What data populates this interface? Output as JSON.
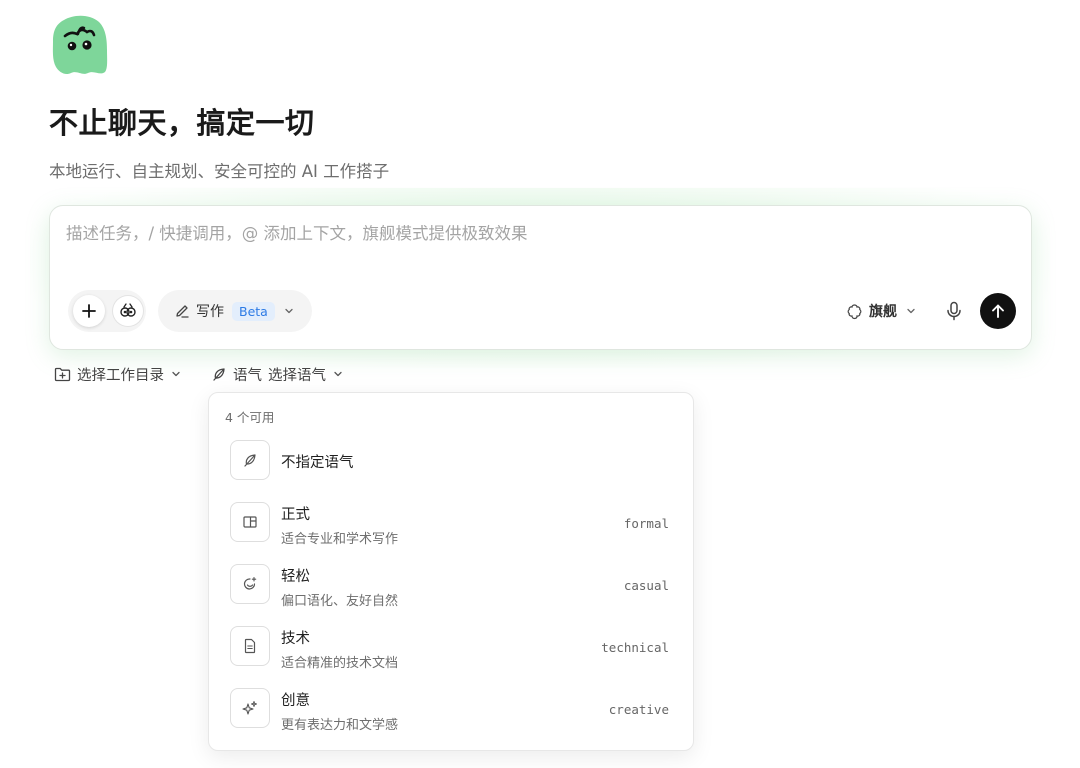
{
  "hero": {
    "title": "不止聊天，搞定一切",
    "subtitle": "本地运行、自主规划、安全可控的 AI 工作搭子"
  },
  "composer": {
    "placeholder": "描述任务，/ 快捷调用，@ 添加上下文，旗舰模式提供极致效果",
    "value": "",
    "mode_label": "写作",
    "mode_badge": "Beta",
    "model_label": "旗舰",
    "icons": {
      "add": "plus-icon",
      "agent": "agent-icon",
      "mode": "pen-icon",
      "model": "flower-icon",
      "voice": "microphone-icon",
      "send": "arrow-up-icon"
    }
  },
  "below": {
    "workdir_label": "选择工作目录",
    "tone_prefix": "语气",
    "tone_label": "选择语气"
  },
  "tone_menu": {
    "count_label": "4 个可用",
    "items": [
      {
        "title": "不指定语气",
        "desc": "",
        "code": "",
        "icon": "feather-icon"
      },
      {
        "title": "正式",
        "desc": "适合专业和学术写作",
        "code": "formal",
        "icon": "layout-panel-icon"
      },
      {
        "title": "轻松",
        "desc": "偏口语化、友好自然",
        "code": "casual",
        "icon": "smile-sparkle-icon"
      },
      {
        "title": "技术",
        "desc": "适合精准的技术文档",
        "code": "technical",
        "icon": "document-icon"
      },
      {
        "title": "创意",
        "desc": "更有表达力和文学感",
        "code": "creative",
        "icon": "sparkles-icon"
      }
    ]
  },
  "colors": {
    "accent_green": "#7ed69a",
    "send_button": "#111111",
    "beta_badge_bg": "#e3eefc",
    "beta_badge_text": "#2d7be5"
  }
}
